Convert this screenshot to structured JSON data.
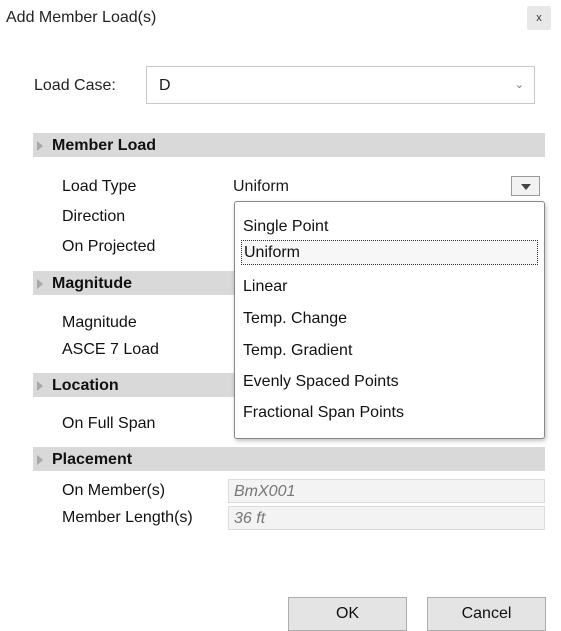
{
  "window": {
    "title": "Add Member Load(s)",
    "close_glyph": "x"
  },
  "load_case": {
    "label": "Load Case:",
    "value": "D"
  },
  "property_grid": {
    "member_load": {
      "category": "Member Load",
      "load_type": {
        "name": "Load Type",
        "value": "Uniform"
      },
      "direction": {
        "name": "Direction"
      },
      "on_projected": {
        "name": "On Projected"
      }
    },
    "magnitude": {
      "category": "Magnitude",
      "magnitude": {
        "name": "Magnitude"
      },
      "asce7": {
        "name": "ASCE 7 Load"
      }
    },
    "location": {
      "category": "Location",
      "on_full_span": {
        "name": "On Full Span"
      }
    },
    "placement": {
      "category": "Placement",
      "on_members": {
        "name": "On Member(s)",
        "value": "BmX001"
      },
      "member_lengths": {
        "name": "Member Length(s)",
        "value": "36 ft"
      }
    }
  },
  "load_type_dropdown": {
    "selected": "Uniform",
    "options": [
      "Single Point",
      "Uniform",
      "Linear",
      "Temp. Change",
      "Temp. Gradient",
      "Evenly Spaced Points",
      "Fractional Span Points"
    ]
  },
  "buttons": {
    "ok": "OK",
    "cancel": "Cancel"
  }
}
